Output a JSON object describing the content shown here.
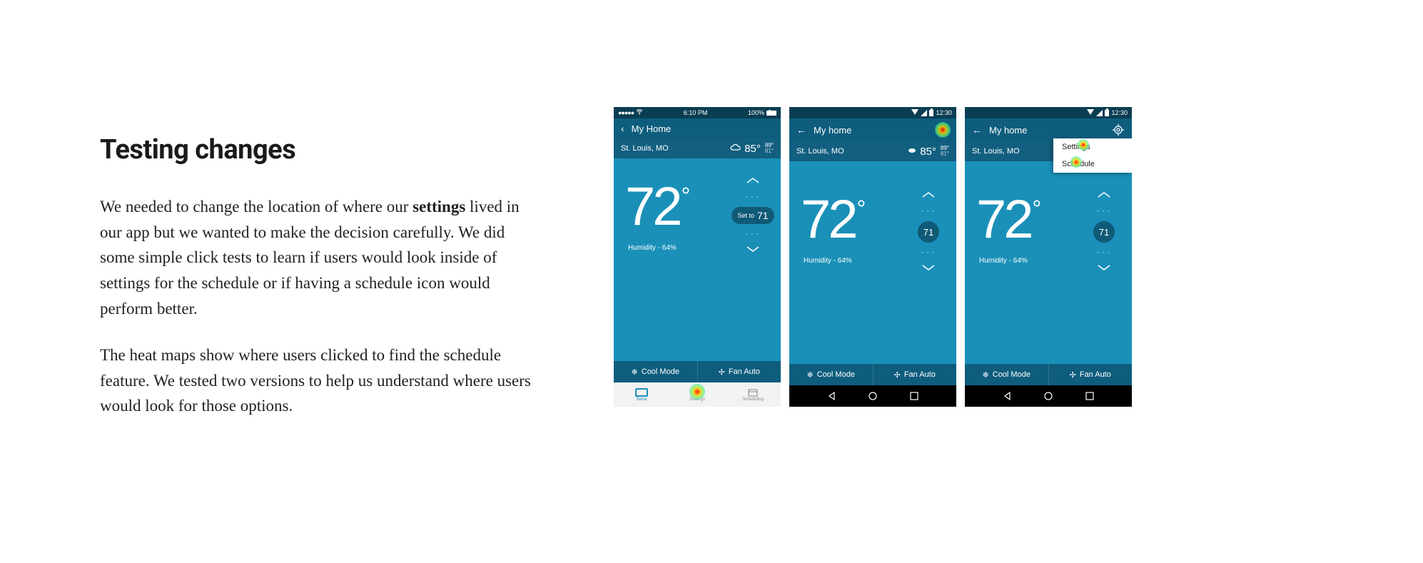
{
  "text": {
    "heading": "Testing changes",
    "p1_a": "We needed to change the location of where our ",
    "p1_bold": "settings",
    "p1_b": " lived in our app but we wanted to make the decision carefully. We did some simple click tests to learn if users would look inside of settings for the schedule or if having a schedule icon would perform better.",
    "p2": "The heat maps show where users clicked to find the schedule feature. We tested two versions to help us understand where users would look for those options."
  },
  "phone1": {
    "status_time": "6:10 PM",
    "status_right": "100%",
    "header_title": "My Home",
    "location": "St. Louis, MO",
    "outdoor_temp": "85°",
    "hi": "89°",
    "lo": "81°",
    "big_temp": "72",
    "set_to_label": "Set to",
    "set_to_value": "71",
    "humidity": "Humidity - 64%",
    "cool_mode": "Cool Mode",
    "fan_auto": "Fan Auto",
    "tab1": "Sensi",
    "tab2": "Settings",
    "tab3": "Scheduling"
  },
  "phone2": {
    "status_time": "12:30",
    "header_title": "My home",
    "location": "St. Louis, MO",
    "outdoor_temp": "85°",
    "hi": "89°",
    "lo": "81°",
    "big_temp": "72",
    "set_to_value": "71",
    "humidity": "Humidity - 64%",
    "cool_mode": "Cool Mode",
    "fan_auto": "Fan Auto"
  },
  "phone3": {
    "status_time": "12:30",
    "header_title": "My home",
    "location": "St. Louis, MO",
    "big_temp": "72",
    "set_to_value": "71",
    "humidity": "Humidity - 64%",
    "cool_mode": "Cool Mode",
    "fan_auto": "Fan Auto",
    "menu_item1": "Settings",
    "menu_item2": "Schedule"
  }
}
